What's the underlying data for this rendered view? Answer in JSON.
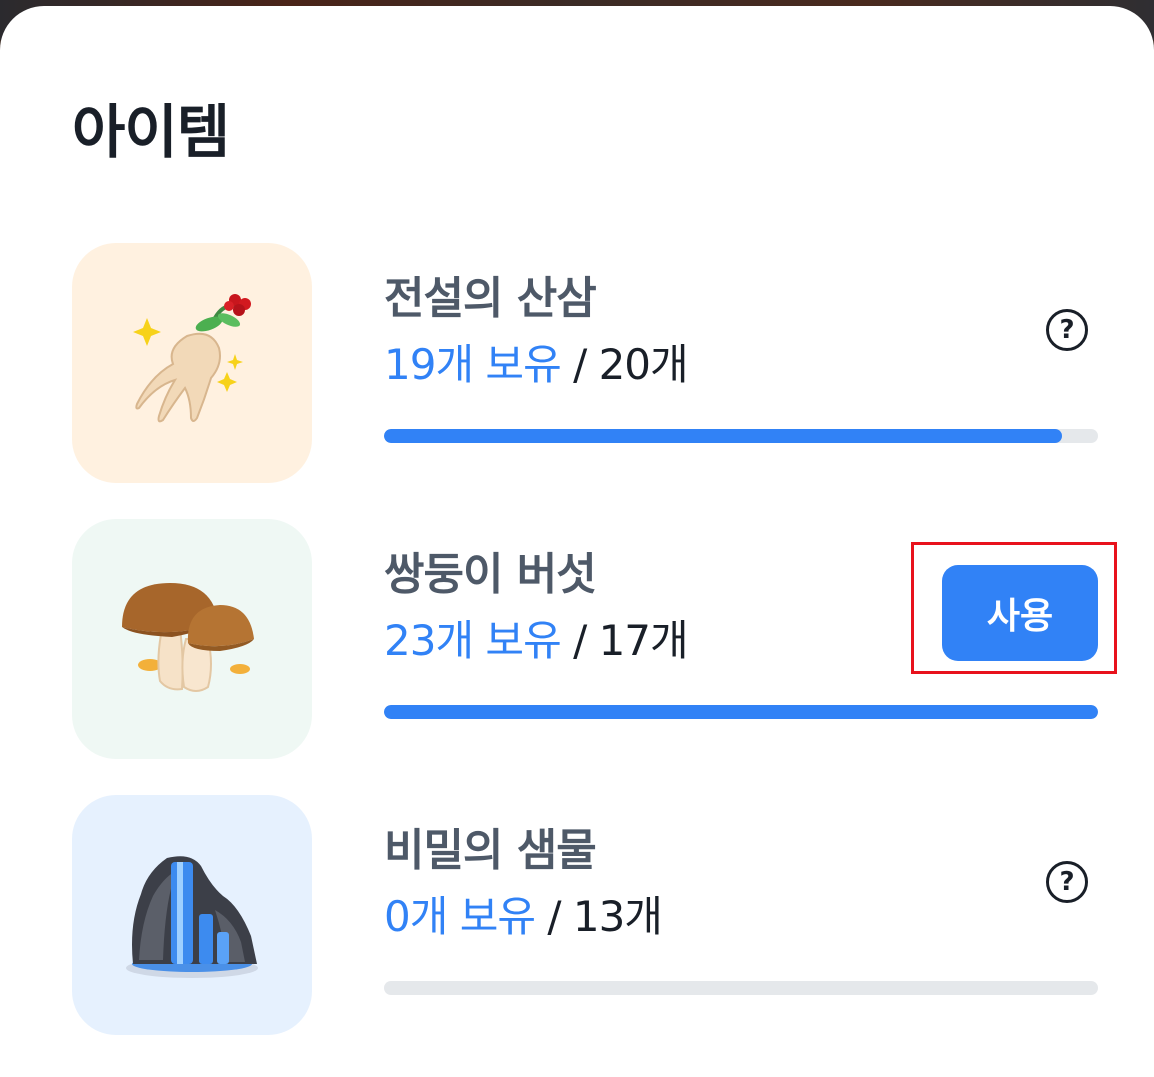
{
  "title": "아이템",
  "items": [
    {
      "name": "전설의 산삼",
      "owned": "19개 보유",
      "separator": " / ",
      "max": "20개",
      "progress": 0.95,
      "thumb_bg": "#fff1e0",
      "action": "help",
      "help_label": "?",
      "icon": "ginseng-icon"
    },
    {
      "name": "쌍둥이 버섯",
      "owned": "23개 보유",
      "separator": " / ",
      "max": "17개",
      "progress": 1.0,
      "thumb_bg": "#eff8f4",
      "action": "use",
      "use_label": "사용",
      "icon": "mushroom-icon"
    },
    {
      "name": "비밀의 샘물",
      "owned": "0개 보유",
      "separator": " / ",
      "max": "13개",
      "progress": 0.0,
      "thumb_bg": "#e6f1fe",
      "action": "help",
      "help_label": "?",
      "icon": "waterfall-icon"
    }
  ],
  "colors": {
    "accent": "#3182f6",
    "track": "#e5e8eb",
    "text_primary": "#191f28",
    "text_secondary": "#4e5968",
    "highlight": "#e8121c"
  }
}
